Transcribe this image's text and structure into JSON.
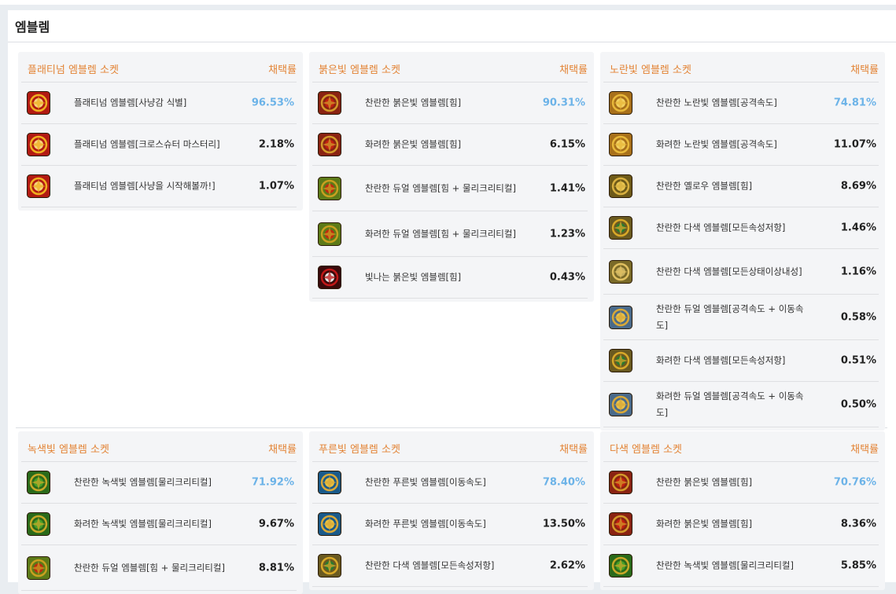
{
  "panel": {
    "title": "엠블렘"
  },
  "columns": {
    "rate_label": "채택률"
  },
  "cards": [
    {
      "name": "플래티넘 엠블렘 소켓",
      "rows": [
        {
          "icon": "platinum-emblem-icon",
          "name": "플래티넘 엠블렘[사냥감 식별]",
          "pct": "96.53%"
        },
        {
          "icon": "platinum-emblem-icon",
          "name": "플래티넘 엠블렘[크로스슈터 마스터리]",
          "pct": "2.18%"
        },
        {
          "icon": "platinum-emblem-icon",
          "name": "플래티넘 엠블렘[사냥을 시작해볼까!]",
          "pct": "1.07%"
        }
      ]
    },
    {
      "name": "붉은빛 엠블렘 소켓",
      "rows": [
        {
          "icon": "red-emblem-icon",
          "name": "찬란한 붉은빛 엠블렘[힘]",
          "pct": "90.31%"
        },
        {
          "icon": "red-emblem-icon",
          "name": "화려한 붉은빛 엠블렘[힘]",
          "pct": "6.15%"
        },
        {
          "icon": "dual-red-green-emblem-icon",
          "name": "찬란한 듀얼 엠블렘[힘 + 물리크리티컬]",
          "pct": "1.41%"
        },
        {
          "icon": "dual-red-green-emblem-icon",
          "name": "화려한 듀얼 엠블렘[힘 + 물리크리티컬]",
          "pct": "1.23%"
        },
        {
          "icon": "shining-red-emblem-icon",
          "name": "빛나는 붉은빛 엠블렘[힘]",
          "pct": "0.43%"
        }
      ]
    },
    {
      "name": "노란빛 엠블렘 소켓",
      "rows": [
        {
          "icon": "yellow-emblem-icon",
          "name": "찬란한 노란빛 엠블렘[공격속도]",
          "pct": "74.81%"
        },
        {
          "icon": "yellow-emblem-icon",
          "name": "화려한 노란빛 엠블렘[공격속도]",
          "pct": "11.07%"
        },
        {
          "icon": "yellow-round-emblem-icon",
          "name": "찬란한 옐로우 엠블렘[힘]",
          "pct": "8.69%"
        },
        {
          "icon": "multicolor-emblem-icon",
          "name": "찬란한 다색 엠블렘[모든속성저항]",
          "pct": "1.46%"
        },
        {
          "icon": "multicolor-status-emblem-icon",
          "name": "찬란한 다색 엠블렘[모든상태이상내성]",
          "pct": "1.16%"
        },
        {
          "icon": "dual-yellow-blue-emblem-icon",
          "name": "찬란한 듀얼 엠블렘[공격속도 + 이동속도]",
          "pct": "0.58%"
        },
        {
          "icon": "multicolor-emblem-icon",
          "name": "화려한 다색 엠블렘[모든속성저항]",
          "pct": "0.51%"
        },
        {
          "icon": "dual-yellow-blue-emblem-icon",
          "name": "화려한 듀얼 엠블렘[공격속도 + 이동속도]",
          "pct": "0.50%"
        }
      ]
    },
    {
      "name": "녹색빛 엠블렘 소켓",
      "rows": [
        {
          "icon": "green-emblem-icon",
          "name": "찬란한 녹색빛 엠블렘[물리크리티컬]",
          "pct": "71.92%"
        },
        {
          "icon": "green-emblem-icon",
          "name": "화려한 녹색빛 엠블렘[물리크리티컬]",
          "pct": "9.67%"
        },
        {
          "icon": "dual-red-green-emblem-icon",
          "name": "찬란한 듀얼 엠블렘[힘 + 물리크리티컬]",
          "pct": "8.81%"
        }
      ]
    },
    {
      "name": "푸른빛 엠블렘 소켓",
      "rows": [
        {
          "icon": "blue-emblem-icon",
          "name": "찬란한 푸른빛 엠블렘[이동속도]",
          "pct": "78.40%"
        },
        {
          "icon": "blue-emblem-icon",
          "name": "화려한 푸른빛 엠블렘[이동속도]",
          "pct": "13.50%"
        },
        {
          "icon": "multicolor-emblem-icon",
          "name": "찬란한 다색 엠블렘[모든속성저항]",
          "pct": "2.62%"
        }
      ]
    },
    {
      "name": "다색 엠블렘 소켓",
      "rows": [
        {
          "icon": "red-emblem-icon",
          "name": "찬란한 붉은빛 엠블렘[힘]",
          "pct": "70.76%"
        },
        {
          "icon": "red-emblem-icon",
          "name": "화려한 붉은빛 엠블렘[힘]",
          "pct": "8.36%"
        },
        {
          "icon": "green-emblem-icon",
          "name": "찬란한 녹색빛 엠블렘[물리크리티컬]",
          "pct": "5.85%"
        }
      ]
    }
  ],
  "colors": {
    "accent": "#e38436",
    "top_rate": "#6cb3e8"
  }
}
